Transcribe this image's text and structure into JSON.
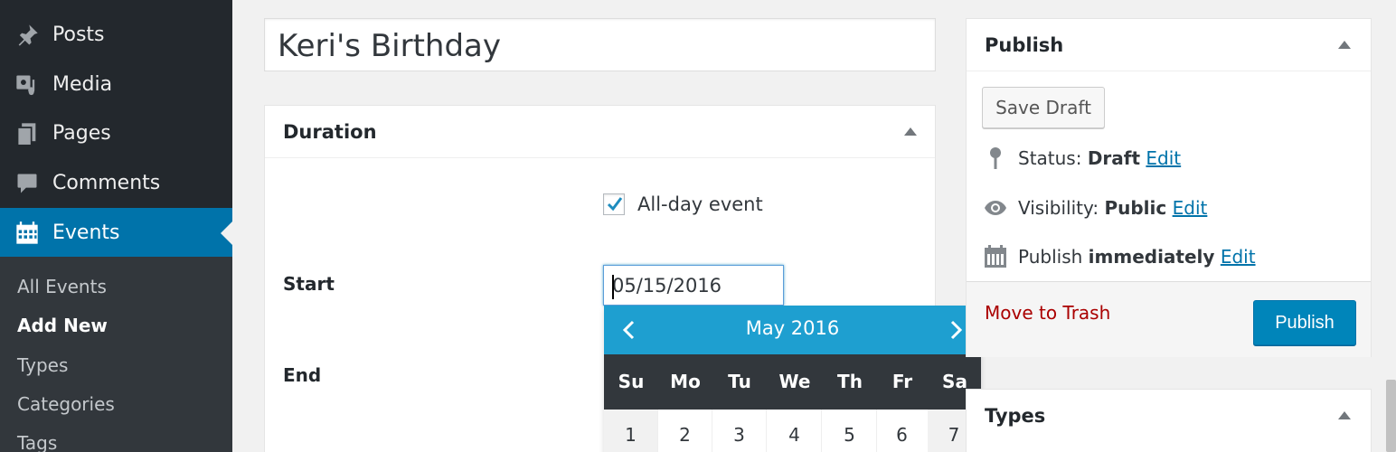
{
  "sidebar": {
    "items": [
      {
        "label": "Posts",
        "icon": "pushpin-icon"
      },
      {
        "label": "Media",
        "icon": "media-icon"
      },
      {
        "label": "Pages",
        "icon": "pages-icon"
      },
      {
        "label": "Comments",
        "icon": "comment-icon"
      },
      {
        "label": "Events",
        "icon": "calendar-icon",
        "active": true
      }
    ],
    "submenu": [
      "All Events",
      "Add New",
      "Types",
      "Categories",
      "Tags"
    ],
    "submenu_current": "Add New"
  },
  "editor": {
    "title_value": "Keri's Birthday"
  },
  "duration": {
    "heading": "Duration",
    "all_day_label": "All-day event",
    "all_day_checked": true,
    "start_label": "Start",
    "start_value": "05/15/2016",
    "end_label": "End"
  },
  "datepicker": {
    "month_year": "May 2016",
    "weekdays": [
      "Su",
      "Mo",
      "Tu",
      "We",
      "Th",
      "Fr",
      "Sa"
    ],
    "first_row": [
      "1",
      "2",
      "3",
      "4",
      "5",
      "6",
      "7"
    ]
  },
  "publish": {
    "heading": "Publish",
    "save_draft": "Save Draft",
    "status_label": "Status:",
    "status_value": "Draft",
    "visibility_label": "Visibility:",
    "visibility_value": "Public",
    "publish_label": "Publish",
    "publish_value": "immediately",
    "edit_link": "Edit",
    "trash_link": "Move to Trash",
    "publish_button": "Publish"
  },
  "types": {
    "heading": "Types"
  },
  "colors": {
    "sidebar_bg": "#23282d",
    "active_bg": "#0073aa",
    "datepicker_header": "#1e9fd0",
    "publish_button": "#0085ba",
    "trash_link": "#a00000"
  }
}
